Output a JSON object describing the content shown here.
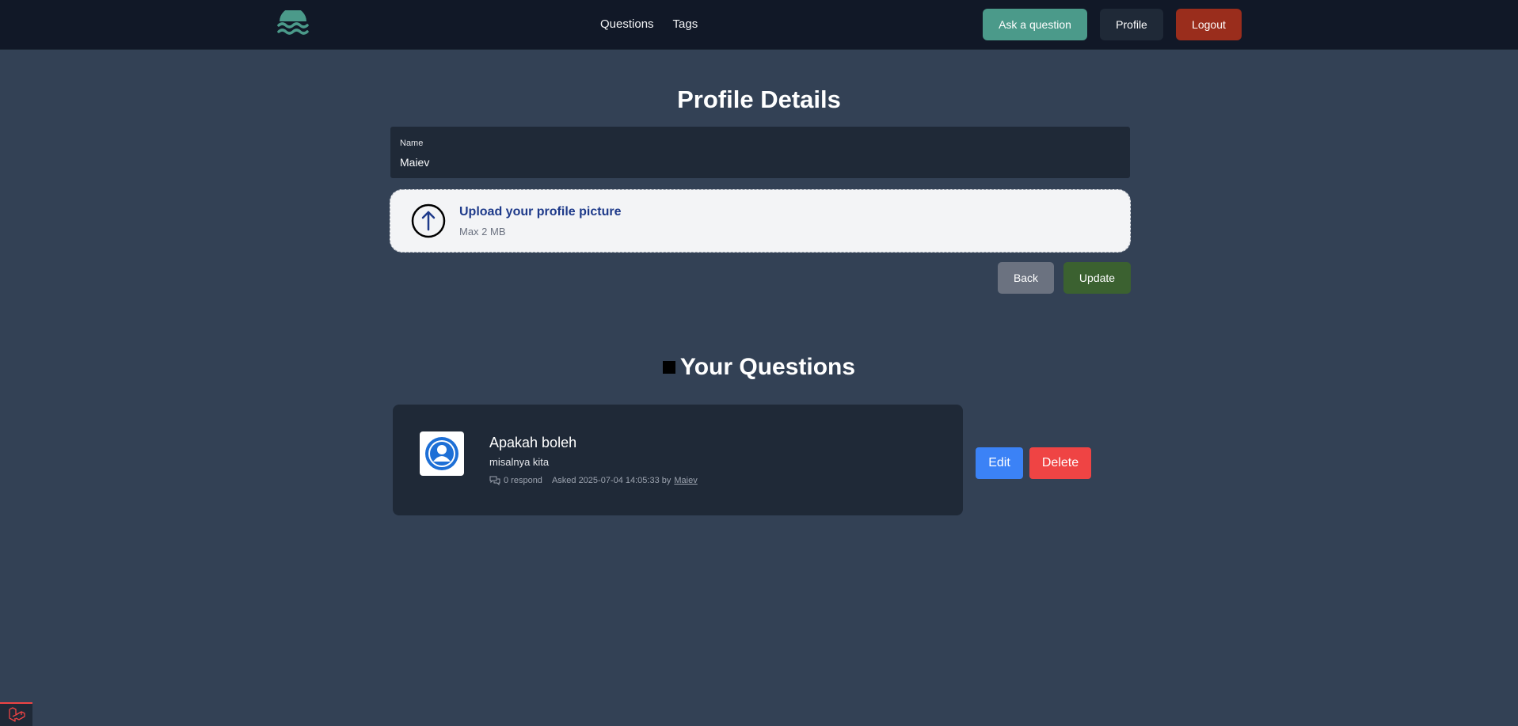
{
  "nav": {
    "links": [
      "Questions",
      "Tags"
    ],
    "ask_label": "Ask a question",
    "profile_label": "Profile",
    "logout_label": "Logout",
    "brand_color": "#4b9a8a"
  },
  "profile": {
    "title": "Profile Details",
    "name_label": "Name",
    "name_value": "Maiev",
    "upload_title": "Upload your profile picture",
    "upload_subtitle": "Max 2 MB",
    "back_label": "Back",
    "update_label": "Update"
  },
  "questions": {
    "title": "Your Questions",
    "items": [
      {
        "title": "Apakah boleh",
        "body": "misalnya kita",
        "responses": "0 respond",
        "asked": "Asked 2025-07-04 14:05:33 by",
        "author": "Maiev",
        "edit_label": "Edit",
        "delete_label": "Delete"
      }
    ]
  },
  "icons": {
    "logo": "waves-logo-icon",
    "upload": "arrow-up-circle-icon",
    "avatar": "user-avatar-icon",
    "comments": "comments-icon",
    "debug": "laravel-logo-icon"
  }
}
